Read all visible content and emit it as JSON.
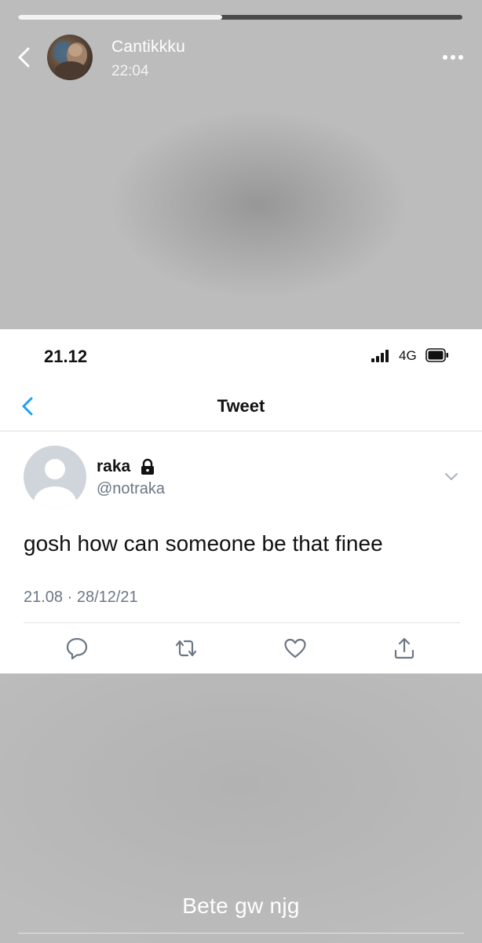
{
  "story": {
    "progress": 0.46,
    "username": "Cantikkku",
    "time": "22:04",
    "caption": "Bete gw njg",
    "icons": {
      "back": "chevron-left-icon",
      "more": "more-horizontal-icon"
    }
  },
  "tweet_screenshot": {
    "status_bar": {
      "time": "21.12",
      "network": "4G",
      "icons": [
        "signal-icon",
        "battery-icon"
      ]
    },
    "nav": {
      "title": "Tweet",
      "back_icon": "chevron-left-icon"
    },
    "author": {
      "name": "raka",
      "handle": "@notraka",
      "protected_icon": "lock-icon"
    },
    "text": "gosh how can someone be that finee",
    "timestamp": "21.08 · 28/12/21",
    "actions": [
      "reply-icon",
      "retweet-icon",
      "like-icon",
      "share-icon"
    ],
    "colors": {
      "accent": "#1da1f2",
      "secondary_text": "#6b7785"
    }
  }
}
